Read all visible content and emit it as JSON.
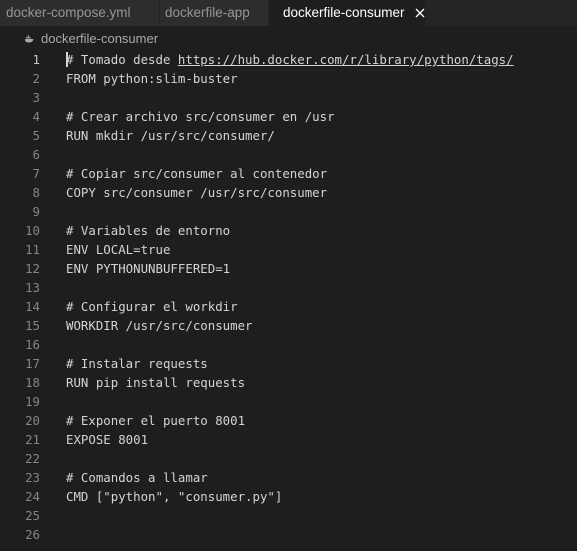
{
  "tabs": [
    {
      "label": "docker-compose.yml"
    },
    {
      "label": "dockerfile-app"
    },
    {
      "label": "dockerfile-consumer",
      "active": true
    }
  ],
  "close_icon": "close-icon",
  "breadcrumb": {
    "icon": "file-icon",
    "label": "dockerfile-consumer"
  },
  "colors": {
    "editor_bg": "#1e1e1e",
    "tabbar_bg": "#252526",
    "inactive_tab_bg": "#2d2d2d",
    "code_text": "#d4d4d4",
    "line_number": "#858585"
  },
  "editor": {
    "lines": [
      {
        "n": "1",
        "pre": "# Tomado desde ",
        "link": "https://hub.docker.com/r/library/python/tags/",
        "post": ""
      },
      {
        "n": "2",
        "text": "FROM python:slim-buster"
      },
      {
        "n": "3",
        "text": ""
      },
      {
        "n": "4",
        "text": "# Crear archivo src/consumer en /usr"
      },
      {
        "n": "5",
        "text": "RUN mkdir /usr/src/consumer/"
      },
      {
        "n": "6",
        "text": ""
      },
      {
        "n": "7",
        "text": "# Copiar src/consumer al contenedor"
      },
      {
        "n": "8",
        "text": "COPY src/consumer /usr/src/consumer"
      },
      {
        "n": "9",
        "text": ""
      },
      {
        "n": "10",
        "text": "# Variables de entorno"
      },
      {
        "n": "11",
        "text": "ENV LOCAL=true"
      },
      {
        "n": "12",
        "text": "ENV PYTHONUNBUFFERED=1"
      },
      {
        "n": "13",
        "text": ""
      },
      {
        "n": "14",
        "text": "# Configurar el workdir"
      },
      {
        "n": "15",
        "text": "WORKDIR /usr/src/consumer"
      },
      {
        "n": "16",
        "text": ""
      },
      {
        "n": "17",
        "text": "# Instalar requests"
      },
      {
        "n": "18",
        "text": "RUN pip install requests"
      },
      {
        "n": "19",
        "text": ""
      },
      {
        "n": "20",
        "text": "# Exponer el puerto 8001"
      },
      {
        "n": "21",
        "text": "EXPOSE 8001"
      },
      {
        "n": "22",
        "text": ""
      },
      {
        "n": "23",
        "text": "# Comandos a llamar"
      },
      {
        "n": "24",
        "text": "CMD [\"python\", \"consumer.py\"]"
      },
      {
        "n": "25",
        "text": ""
      },
      {
        "n": "26",
        "text": ""
      }
    ]
  }
}
